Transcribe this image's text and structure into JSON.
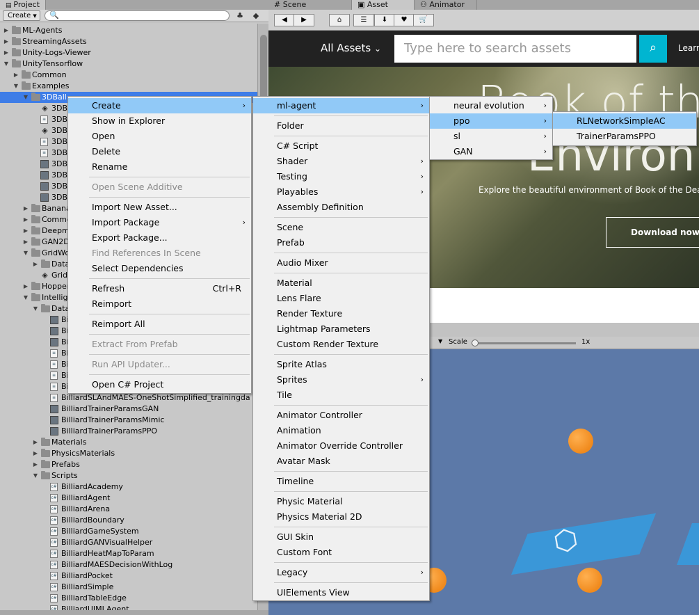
{
  "project": {
    "tab_label": "Project",
    "create_label": "Create",
    "search_value": "",
    "tree": [
      {
        "label": "ML-Agents",
        "type": "folder",
        "depth": 0,
        "expanded": false
      },
      {
        "label": "StreamingAssets",
        "type": "folder",
        "depth": 0,
        "expanded": false
      },
      {
        "label": "Unity-Logs-Viewer",
        "type": "folder",
        "depth": 0,
        "expanded": false
      },
      {
        "label": "UnityTensorflow",
        "type": "folder",
        "depth": 0,
        "expanded": true
      },
      {
        "label": "Common",
        "type": "folder",
        "depth": 1,
        "expanded": false
      },
      {
        "label": "Examples",
        "type": "folder",
        "depth": 1,
        "expanded": true
      },
      {
        "label": "3DBall",
        "type": "folder",
        "depth": 2,
        "expanded": true,
        "selected": true
      },
      {
        "label": "3DBall",
        "type": "unity",
        "depth": 3
      },
      {
        "label": "3DBall",
        "type": "file",
        "depth": 3
      },
      {
        "label": "3DBall",
        "type": "unity",
        "depth": 3
      },
      {
        "label": "3DBall",
        "type": "file",
        "depth": 3
      },
      {
        "label": "3DBall",
        "type": "file",
        "depth": 3
      },
      {
        "label": "3DBall",
        "type": "prefab",
        "depth": 3
      },
      {
        "label": "3DBall",
        "type": "prefab",
        "depth": 3
      },
      {
        "label": "3DBall",
        "type": "prefab",
        "depth": 3
      },
      {
        "label": "3DBall",
        "type": "prefab",
        "depth": 3
      },
      {
        "label": "Banana",
        "type": "folder",
        "depth": 2,
        "expanded": false
      },
      {
        "label": "Common",
        "type": "folder",
        "depth": 2,
        "expanded": false
      },
      {
        "label": "Deepmind",
        "type": "folder",
        "depth": 2,
        "expanded": false
      },
      {
        "label": "GAN2D",
        "type": "folder",
        "depth": 2,
        "expanded": false
      },
      {
        "label": "GridWorld",
        "type": "folder",
        "depth": 2,
        "expanded": true
      },
      {
        "label": "Data",
        "type": "folder",
        "depth": 3,
        "expanded": false
      },
      {
        "label": "Grid",
        "type": "unity",
        "depth": 3
      },
      {
        "label": "Hopper",
        "type": "folder",
        "depth": 2,
        "expanded": false
      },
      {
        "label": "IntelligentPool",
        "type": "folder",
        "depth": 2,
        "expanded": true
      },
      {
        "label": "Data",
        "type": "folder",
        "depth": 3,
        "expanded": true
      },
      {
        "label": "Billiard",
        "type": "prefab",
        "depth": 4
      },
      {
        "label": "Billiard",
        "type": "prefab",
        "depth": 4
      },
      {
        "label": "Billiard",
        "type": "prefab",
        "depth": 4
      },
      {
        "label": "Billiard",
        "type": "file",
        "depth": 4
      },
      {
        "label": "Billiard",
        "type": "file",
        "depth": 4
      },
      {
        "label": "Billiard",
        "type": "file",
        "depth": 4
      },
      {
        "label": "Billiard",
        "type": "file",
        "depth": 4
      },
      {
        "label": "BilliardSLAndMAES-OneShotSimplified_trainingda",
        "type": "file",
        "depth": 4
      },
      {
        "label": "BilliardTrainerParamsGAN",
        "type": "prefab",
        "depth": 4
      },
      {
        "label": "BilliardTrainerParamsMimic",
        "type": "prefab",
        "depth": 4
      },
      {
        "label": "BilliardTrainerParamsPPO",
        "type": "prefab",
        "depth": 4
      },
      {
        "label": "Materials",
        "type": "folder",
        "depth": 3,
        "expanded": false
      },
      {
        "label": "PhysicsMaterials",
        "type": "folder",
        "depth": 3,
        "expanded": false
      },
      {
        "label": "Prefabs",
        "type": "folder",
        "depth": 3,
        "expanded": false
      },
      {
        "label": "Scripts",
        "type": "folder",
        "depth": 3,
        "expanded": true
      },
      {
        "label": "BilliardAcademy",
        "type": "script",
        "depth": 4
      },
      {
        "label": "BilliardAgent",
        "type": "script",
        "depth": 4
      },
      {
        "label": "BilliardArena",
        "type": "script",
        "depth": 4
      },
      {
        "label": "BilliardBoundary",
        "type": "script",
        "depth": 4
      },
      {
        "label": "BilliardGameSystem",
        "type": "script",
        "depth": 4
      },
      {
        "label": "BilliardGANVisualHelper",
        "type": "script",
        "depth": 4
      },
      {
        "label": "BilliardHeatMapToParam",
        "type": "script",
        "depth": 4
      },
      {
        "label": "BilliardMAESDecisionWithLog",
        "type": "script",
        "depth": 4
      },
      {
        "label": "BilliardPocket",
        "type": "script",
        "depth": 4
      },
      {
        "label": "BilliardSimple",
        "type": "script",
        "depth": 4
      },
      {
        "label": "BilliardTableEdge",
        "type": "script",
        "depth": 4
      },
      {
        "label": "BilliardUIMLAgent",
        "type": "script",
        "depth": 4
      }
    ]
  },
  "right_tabs": [
    "Scene",
    "Asset Store",
    "Animator"
  ],
  "store": {
    "all_assets": "All Assets",
    "search_placeholder": "Type here to search assets",
    "learn": "Learn",
    "hero_title_line1": "Book of the",
    "hero_title_line2": "Environm",
    "hero_desc": "Explore the beautiful environment of Book of the Dead",
    "download_label": "Download now"
  },
  "scene_toolbar": {
    "scale_label": "Scale",
    "scale_value": "1x"
  },
  "menus": {
    "main": [
      {
        "label": "Create",
        "submenu": true,
        "highlight": true
      },
      {
        "label": "Show in Explorer"
      },
      {
        "label": "Open"
      },
      {
        "label": "Delete"
      },
      {
        "label": "Rename"
      },
      {
        "sep": true
      },
      {
        "label": "Open Scene Additive",
        "disabled": true
      },
      {
        "sep": true
      },
      {
        "label": "Import New Asset..."
      },
      {
        "label": "Import Package",
        "submenu": true
      },
      {
        "label": "Export Package..."
      },
      {
        "label": "Find References In Scene",
        "disabled": true
      },
      {
        "label": "Select Dependencies"
      },
      {
        "sep": true
      },
      {
        "label": "Refresh",
        "shortcut": "Ctrl+R"
      },
      {
        "label": "Reimport"
      },
      {
        "sep": true
      },
      {
        "label": "Reimport All"
      },
      {
        "sep": true
      },
      {
        "label": "Extract From Prefab",
        "disabled": true
      },
      {
        "sep": true
      },
      {
        "label": "Run API Updater...",
        "disabled": true
      },
      {
        "sep": true
      },
      {
        "label": "Open C# Project"
      }
    ],
    "create": [
      {
        "label": "ml-agent",
        "submenu": true,
        "highlight": true
      },
      {
        "sep": true
      },
      {
        "label": "Folder"
      },
      {
        "sep": true
      },
      {
        "label": "C# Script"
      },
      {
        "label": "Shader",
        "submenu": true
      },
      {
        "label": "Testing",
        "submenu": true
      },
      {
        "label": "Playables",
        "submenu": true
      },
      {
        "label": "Assembly Definition"
      },
      {
        "sep": true
      },
      {
        "label": "Scene"
      },
      {
        "label": "Prefab"
      },
      {
        "sep": true
      },
      {
        "label": "Audio Mixer"
      },
      {
        "sep": true
      },
      {
        "label": "Material"
      },
      {
        "label": "Lens Flare"
      },
      {
        "label": "Render Texture"
      },
      {
        "label": "Lightmap Parameters"
      },
      {
        "label": "Custom Render Texture"
      },
      {
        "sep": true
      },
      {
        "label": "Sprite Atlas"
      },
      {
        "label": "Sprites",
        "submenu": true
      },
      {
        "label": "Tile"
      },
      {
        "sep": true
      },
      {
        "label": "Animator Controller"
      },
      {
        "label": "Animation"
      },
      {
        "label": "Animator Override Controller"
      },
      {
        "label": "Avatar Mask"
      },
      {
        "sep": true
      },
      {
        "label": "Timeline"
      },
      {
        "sep": true
      },
      {
        "label": "Physic Material"
      },
      {
        "label": "Physics Material 2D"
      },
      {
        "sep": true
      },
      {
        "label": "GUI Skin"
      },
      {
        "label": "Custom Font"
      },
      {
        "sep": true
      },
      {
        "label": "Legacy",
        "submenu": true
      },
      {
        "sep": true
      },
      {
        "label": "UIElements View"
      }
    ],
    "mlagent": [
      {
        "label": "neural evolution",
        "submenu": true
      },
      {
        "label": "ppo",
        "submenu": true,
        "highlight": true
      },
      {
        "label": "sl",
        "submenu": true
      },
      {
        "label": "GAN",
        "submenu": true
      }
    ],
    "ppo": [
      {
        "label": "RLNetworkSimpleAC",
        "highlight": true
      },
      {
        "label": "TrainerParamsPPO"
      }
    ]
  }
}
